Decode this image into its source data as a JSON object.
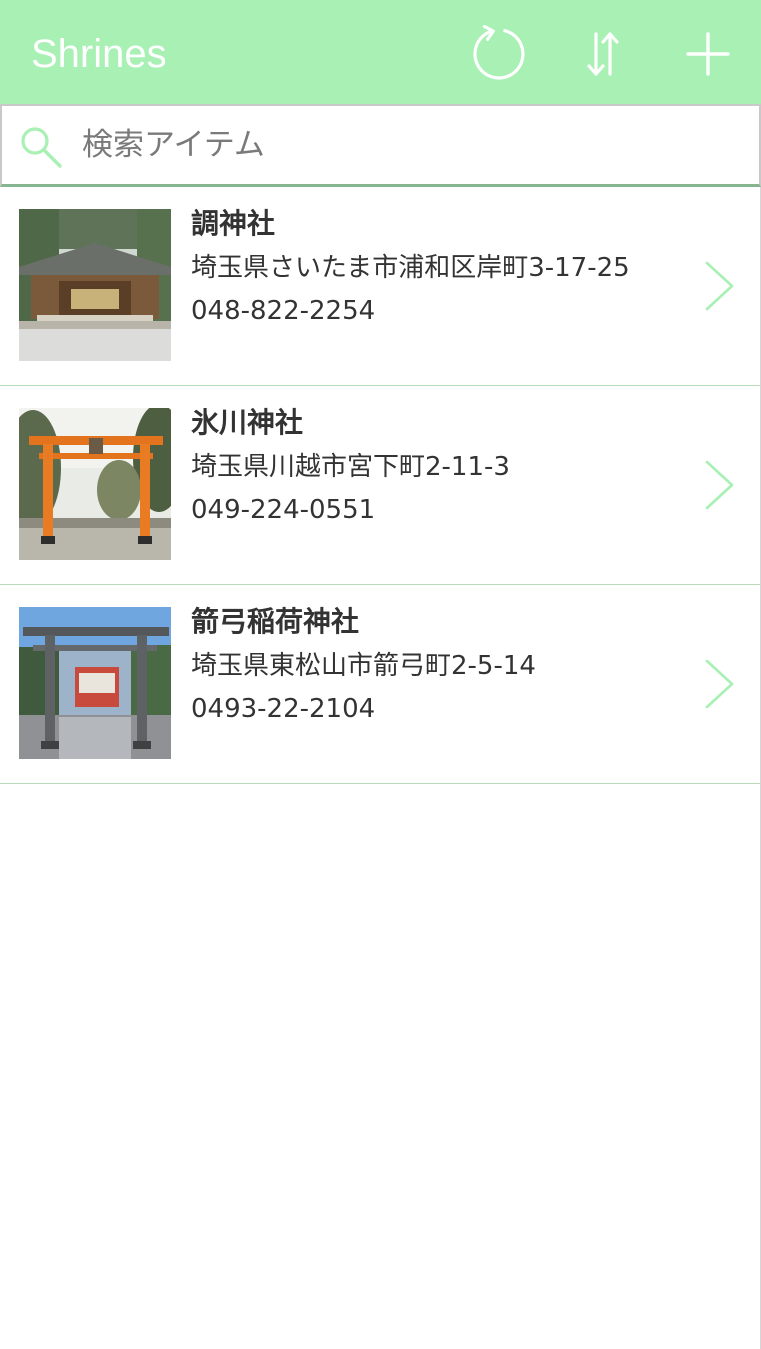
{
  "header": {
    "title": "Shrines",
    "background_color": "#a8f0b4",
    "icons": [
      "reload-icon",
      "sort-icon",
      "add-icon"
    ]
  },
  "search": {
    "placeholder": "検索アイテム",
    "value": "",
    "icon": "search-icon"
  },
  "colors": {
    "accent": "#a8f0b4",
    "text": "#333333",
    "divider": "#b9dcbd"
  },
  "items": [
    {
      "name": "調神社",
      "address": "埼玉県さいたま市浦和区岸町3-17-25",
      "phone": "048-822-2254",
      "image": "shrine-hall-photo"
    },
    {
      "name": "氷川神社",
      "address": "埼玉県川越市宮下町2-11-3",
      "phone": "049-224-0551",
      "image": "orange-torii-photo"
    },
    {
      "name": "箭弓稲荷神社",
      "address": "埼玉県東松山市箭弓町2-5-14",
      "phone": "0493-22-2104",
      "image": "stone-torii-photo"
    }
  ]
}
